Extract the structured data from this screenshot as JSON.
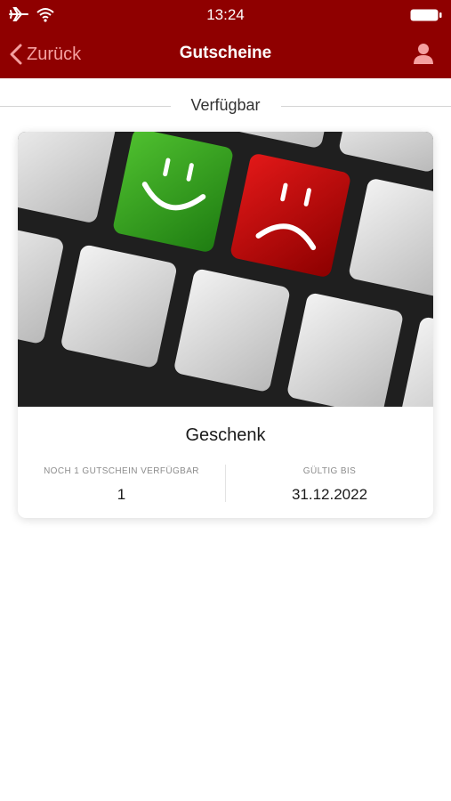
{
  "status_bar": {
    "time": "13:24"
  },
  "nav": {
    "back_label": "Zurück",
    "title": "Gutscheine",
    "accent_color": "#8f0000"
  },
  "section": {
    "title": "Verfügbar"
  },
  "voucher": {
    "title": "Geschenk",
    "available_label": "NOCH 1 GUTSCHEIN VERFÜGBAR",
    "available_value": "1",
    "valid_label": "GÜLTIG BIS",
    "valid_value": "31.12.2022"
  },
  "icons": [
    "airplane-icon",
    "wifi-icon",
    "battery-icon",
    "chevron-left-icon",
    "user-icon"
  ]
}
